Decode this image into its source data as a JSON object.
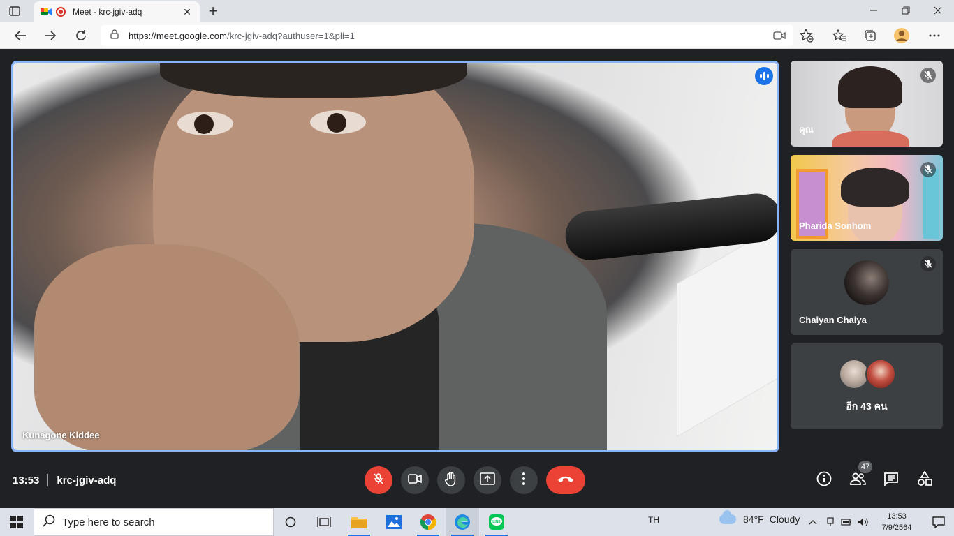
{
  "browser": {
    "tab_title": "Meet - krc-jgiv-adq",
    "url_host": "https://meet.google.com",
    "url_path": "/krc-jgiv-adq?authuser=1&pli=1"
  },
  "meet": {
    "main_participant": "Kunagone Kiddee",
    "tiles": [
      {
        "name": "คุณ",
        "muted": true
      },
      {
        "name": "Pharida Sonhom",
        "muted": true
      },
      {
        "name": "Chaiyan Chaiya",
        "muted": true
      },
      {
        "name": "อีก 43 คน"
      }
    ],
    "time": "13:53",
    "meeting_code": "krc-jgiv-adq",
    "people_count": "47",
    "colors": {
      "accent": "#8ab4f8",
      "end_call": "#ea4335",
      "speaking": "#1a73e8"
    }
  },
  "taskbar": {
    "search_placeholder": "Type here to search",
    "language": "TH",
    "weather_temp": "84°F",
    "weather_desc": "Cloudy",
    "clock_time": "13:53",
    "clock_date": "7/9/2564"
  },
  "icons": [
    "tab-actions-icon",
    "meet-favicon",
    "recording-icon",
    "close-tab-icon",
    "new-tab-icon",
    "minimize-icon",
    "restore-icon",
    "close-window-icon",
    "back-icon",
    "forward-icon",
    "refresh-icon",
    "lock-icon",
    "camera-permission-icon",
    "favorite-add-icon",
    "favorites-icon",
    "collections-icon",
    "profile-icon",
    "more-icon",
    "speaking-indicator-icon",
    "mic-off-icon",
    "camera-icon",
    "raise-hand-icon",
    "present-icon",
    "more-options-icon",
    "end-call-icon",
    "info-icon",
    "people-icon",
    "chat-icon",
    "activities-icon",
    "windows-start-icon",
    "search-icon",
    "cortana-icon",
    "task-view-icon",
    "file-explorer-icon",
    "photos-icon",
    "chrome-icon",
    "edge-icon",
    "line-icon",
    "weather-icon",
    "chevron-up-icon",
    "network-icon",
    "battery-icon",
    "volume-icon",
    "notifications-icon"
  ]
}
